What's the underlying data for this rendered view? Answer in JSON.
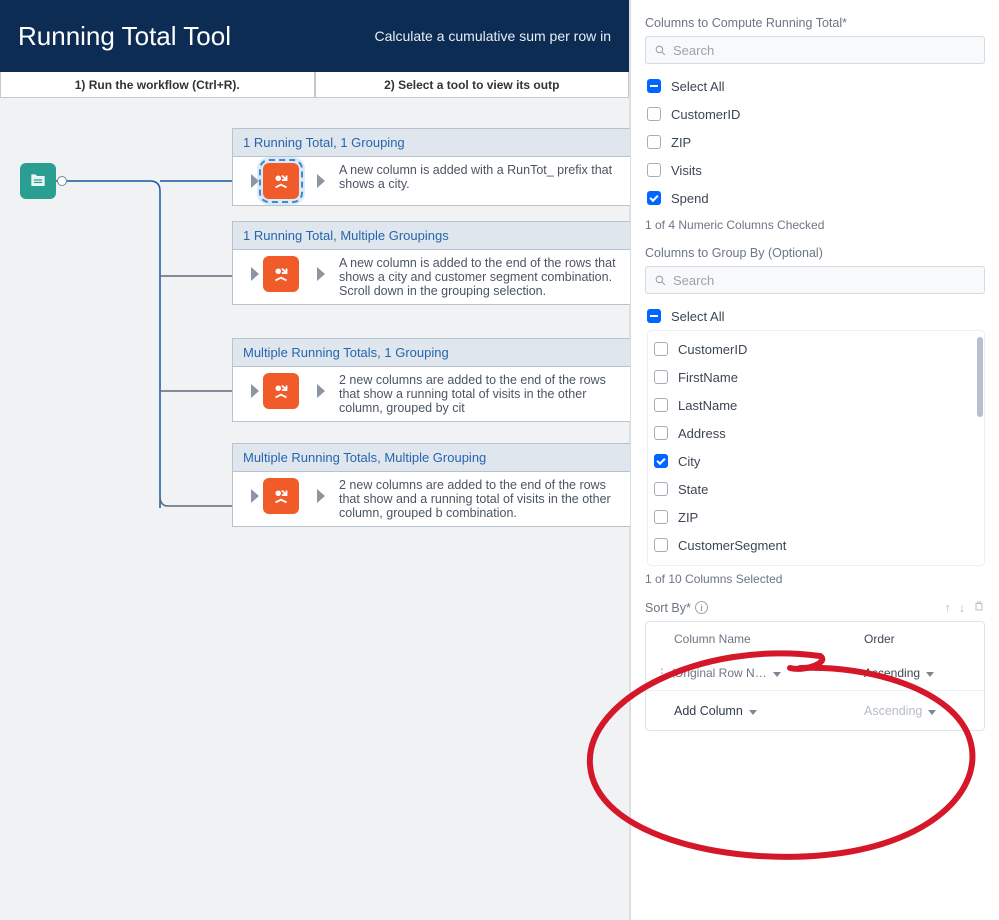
{
  "banner": {
    "title": "Running Total Tool",
    "subtitle": "Calculate a cumulative sum per row in "
  },
  "instructions": {
    "step1": "1) Run the workflow (Ctrl+R).",
    "step2": "2) Select a tool to view its outp"
  },
  "examples": [
    {
      "title": "1 Running Total, 1 Grouping",
      "desc": "A new column is added with a RunTot_ prefix that shows a city."
    },
    {
      "title": "1 Running Total, Multiple Groupings",
      "desc": "A new column is added to the end of the rows that shows a city and customer segment combination. Scroll down in the grouping selection."
    },
    {
      "title": "Multiple Running Totals, 1 Grouping",
      "desc": "2 new columns are added to the end of the rows that show a running total of visits in the other column, grouped by cit"
    },
    {
      "title": "Multiple Running Totals, Multiple Grouping",
      "desc": "2 new columns are added to the end of the rows that show and a running total of visits in the other column, grouped b combination."
    }
  ],
  "panel": {
    "compute": {
      "label": "Columns to Compute Running Total*",
      "search_placeholder": "Search",
      "select_all": "Select All",
      "items": [
        {
          "label": "CustomerID",
          "checked": false
        },
        {
          "label": "ZIP",
          "checked": false
        },
        {
          "label": "Visits",
          "checked": false
        },
        {
          "label": "Spend",
          "checked": true
        }
      ],
      "summary": "1 of 4 Numeric Columns Checked"
    },
    "groupby": {
      "label": "Columns to Group By (Optional)",
      "search_placeholder": "Search",
      "select_all": "Select All",
      "items": [
        {
          "label": "CustomerID",
          "checked": false
        },
        {
          "label": "FirstName",
          "checked": false
        },
        {
          "label": "LastName",
          "checked": false
        },
        {
          "label": "Address",
          "checked": false
        },
        {
          "label": "City",
          "checked": true
        },
        {
          "label": "State",
          "checked": false
        },
        {
          "label": "ZIP",
          "checked": false
        },
        {
          "label": "CustomerSegment",
          "checked": false
        }
      ],
      "summary": "1 of 10 Columns Selected"
    },
    "sort": {
      "label": "Sort By*",
      "headers": {
        "col": "Column Name",
        "order": "Order"
      },
      "rows": [
        {
          "col": "Original Row N…",
          "order": "Ascending",
          "placeholder": false
        },
        {
          "col": "Add Column",
          "order": "Ascending",
          "placeholder": true
        }
      ]
    }
  }
}
